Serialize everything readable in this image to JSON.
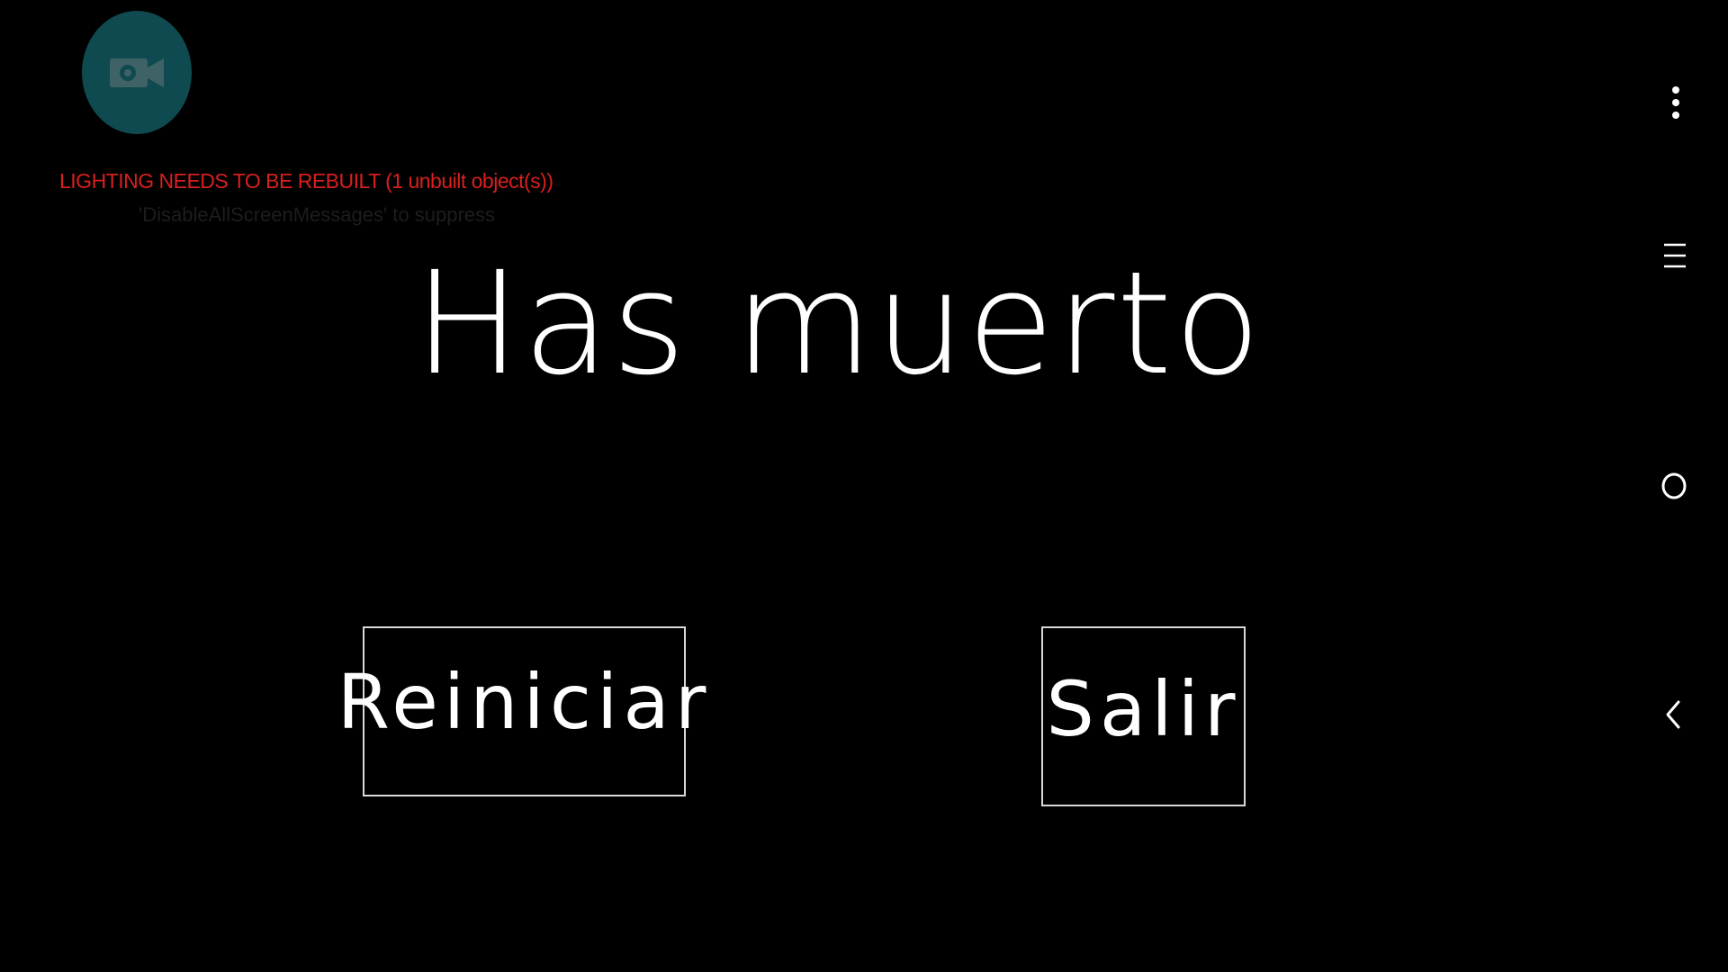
{
  "app": {
    "background_color": "#000000"
  },
  "overlay": {
    "record_icon": "video-camera-icon",
    "record_button_color": "#0f4a50",
    "record_icon_color": "#3f6266"
  },
  "debug": {
    "warning": "LIGHTING NEEDS TO BE REBUILT (1 unbuilt object(s))",
    "warning_color": "#d91f1f",
    "suppress_hint": "'DisableAllScreenMessages' to suppress",
    "suppress_hint_color": "#1d1d1d"
  },
  "game_over": {
    "title": "Has muerto",
    "restart_label": "Reiniciar",
    "exit_label": "Salir"
  },
  "navigation": {
    "more_icon": "more-vertical-icon",
    "menu_icon": "menu-icon",
    "home_icon": "home-circle-icon",
    "back_icon": "back-chevron-icon",
    "icon_color": "#ffffff"
  }
}
